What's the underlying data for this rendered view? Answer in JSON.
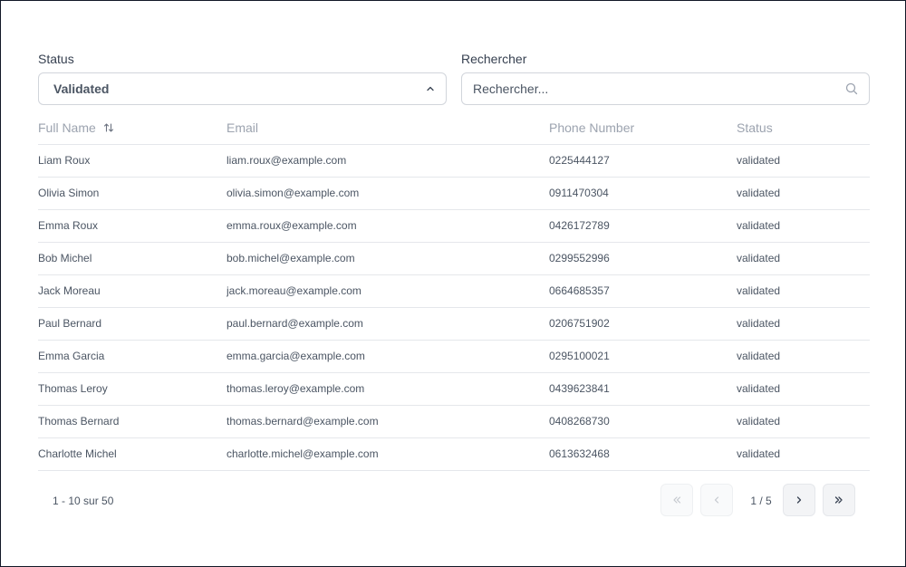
{
  "filters": {
    "status_label": "Status",
    "status_value": "Validated",
    "search_label": "Rechercher",
    "search_placeholder": "Rechercher...",
    "search_value": ""
  },
  "table": {
    "columns": [
      "Full Name",
      "Email",
      "Phone Number",
      "Status"
    ],
    "rows": [
      {
        "name": "Liam Roux",
        "email": "liam.roux@example.com",
        "phone": "0225444127",
        "status": "validated"
      },
      {
        "name": "Olivia Simon",
        "email": "olivia.simon@example.com",
        "phone": "0911470304",
        "status": "validated"
      },
      {
        "name": "Emma Roux",
        "email": "emma.roux@example.com",
        "phone": "0426172789",
        "status": "validated"
      },
      {
        "name": "Bob Michel",
        "email": "bob.michel@example.com",
        "phone": "0299552996",
        "status": "validated"
      },
      {
        "name": "Jack Moreau",
        "email": "jack.moreau@example.com",
        "phone": "0664685357",
        "status": "validated"
      },
      {
        "name": "Paul Bernard",
        "email": "paul.bernard@example.com",
        "phone": "0206751902",
        "status": "validated"
      },
      {
        "name": "Emma Garcia",
        "email": "emma.garcia@example.com",
        "phone": "0295100021",
        "status": "validated"
      },
      {
        "name": "Thomas Leroy",
        "email": "thomas.leroy@example.com",
        "phone": "0439623841",
        "status": "validated"
      },
      {
        "name": "Thomas Bernard",
        "email": "thomas.bernard@example.com",
        "phone": "0408268730",
        "status": "validated"
      },
      {
        "name": "Charlotte Michel",
        "email": "charlotte.michel@example.com",
        "phone": "0613632468",
        "status": "validated"
      }
    ]
  },
  "pagination": {
    "range_text": "1 - 10 sur 50",
    "page_indicator": "1 / 5"
  },
  "icons": {
    "sort": "sort-arrows-icon",
    "select": "chevron-up-icon",
    "search": "search-icon",
    "first": "chevrons-left-icon",
    "prev": "chevron-left-icon",
    "next": "chevron-right-icon",
    "last": "chevrons-right-icon"
  }
}
